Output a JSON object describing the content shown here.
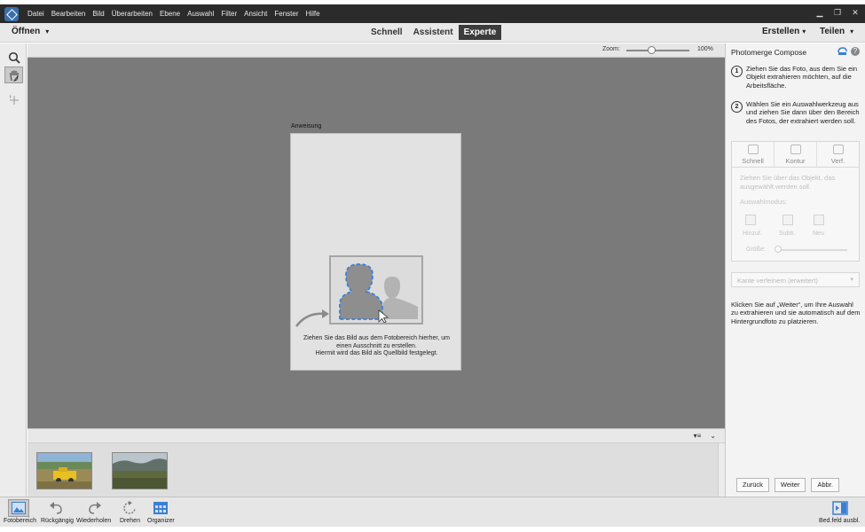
{
  "menubar": {
    "items": [
      "Datei",
      "Bearbeiten",
      "Bild",
      "Überarbeiten",
      "Ebene",
      "Auswahl",
      "Filter",
      "Ansicht",
      "Fenster",
      "Hilfe"
    ],
    "window_controls": [
      "▁",
      "❐",
      "✕"
    ]
  },
  "modebar": {
    "open_label": "Öffnen",
    "tabs": [
      {
        "label": "Schnell",
        "active": false
      },
      {
        "label": "Assistent",
        "active": false
      },
      {
        "label": "Experte",
        "active": true
      }
    ],
    "create_label": "Erstellen",
    "share_label": "Teilen"
  },
  "toolbar": {
    "tools": [
      "zoom-icon",
      "hand-icon",
      "move-icon"
    ]
  },
  "canvas": {
    "zoom_label": "Zoom:",
    "zoom_value": "100%",
    "zoom_fraction": 0.34,
    "doc_label": "Anweisung",
    "instruction_line1": "Ziehen Sie das Bild aus dem Fotobereich hierher, um",
    "instruction_line2": "einen Ausschnitt zu erstellen.",
    "instruction_line3": "Hiermit wird das Bild als Quellbild festgelegt."
  },
  "photobin": {
    "thumbnails": [
      "thumbnail-field-yellow-vehicle",
      "thumbnail-landscape"
    ]
  },
  "panel": {
    "title": "Photomerge Compose",
    "step1_num": "1",
    "step1_text": "Ziehen Sie das Foto, aus dem Sie ein Objekt extrahieren möchten, auf die Arbeitsfläche.",
    "step2_num": "2",
    "step2_text": "Wählen Sie ein Auswahlwerkzeug aus und ziehen Sie dann über den Bereich des Fotos, der extrahiert werden soll.",
    "sel_tabs": [
      "Schnell",
      "Kontur",
      "Verf."
    ],
    "sel_hint": "Ziehen Sie über das Objekt, das ausgewählt werden soll.",
    "sel_mode_label": "Auswahlmodus:",
    "mode_buttons": [
      "Hinzuf.",
      "Subtr.",
      "Neu"
    ],
    "size_label": "Größe:",
    "refine_label": "Kante verfeinern (erweitert)",
    "final_text": "Klicken Sie auf „Weiter“, um Ihre Auswahl zu extrahieren und sie automatisch auf dem Hintergrundfoto zu platzieren.",
    "buttons": {
      "back": "Zurück",
      "next": "Weiter",
      "cancel": "Abbr."
    }
  },
  "bottombar": {
    "items": [
      "Fotobereich",
      "Rückgängig",
      "Wiederholen",
      "Drehen",
      "Organizer"
    ],
    "right_label": "Bed.feld ausbl."
  },
  "colors": {
    "menubar_bg": "#2b2b2b",
    "canvas_bg": "#7a7a7a",
    "accent_blue": "#3b7fd4",
    "active_tab_bg": "#3c3c3c"
  }
}
